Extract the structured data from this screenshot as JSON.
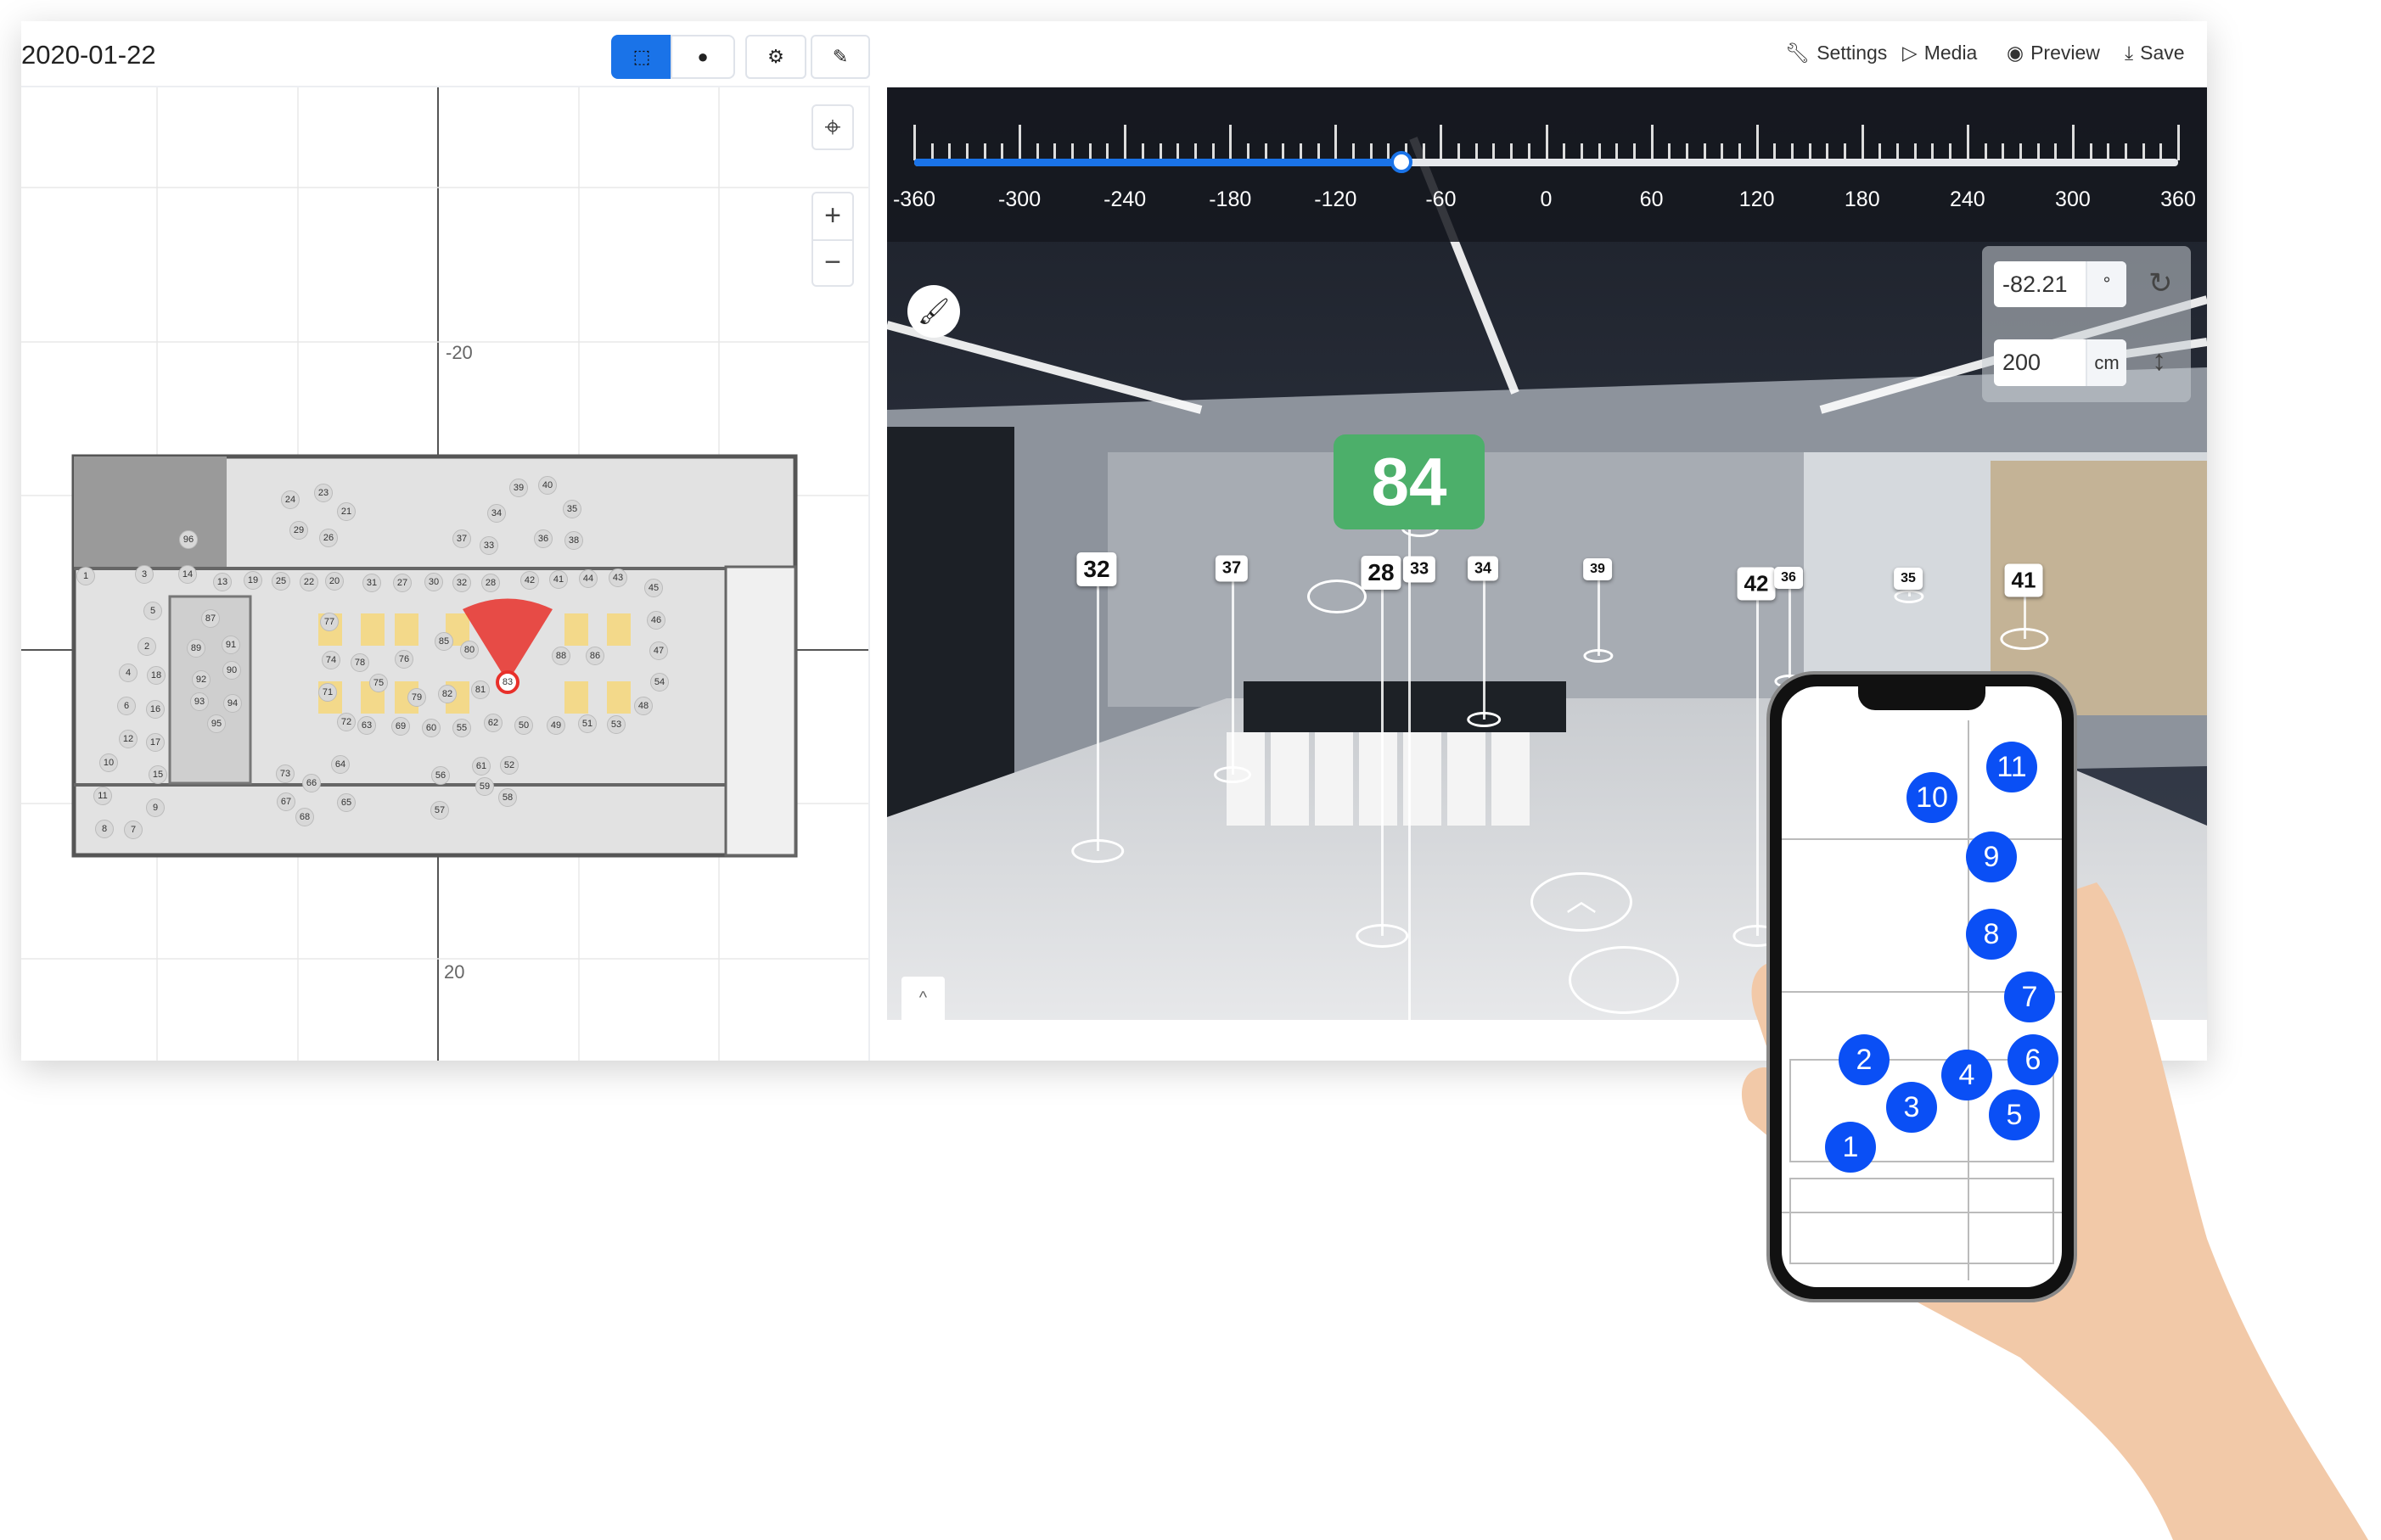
{
  "left_panel": {
    "date": "2020-01-22",
    "tools": [
      {
        "name": "select",
        "icon": "select-cursor-icon"
      },
      {
        "name": "pan",
        "icon": "hand-icon"
      },
      {
        "name": "settings",
        "icon": "gear-icon"
      },
      {
        "name": "edit",
        "icon": "pencil-icon"
      }
    ],
    "map": {
      "axis_labels": [
        "-20",
        "20"
      ],
      "zoom_in": "+",
      "zoom_out": "−",
      "seats": [
        "1",
        "3",
        "14",
        "13",
        "19",
        "25",
        "22",
        "20",
        "31",
        "27",
        "30",
        "32",
        "28",
        "42",
        "41",
        "44",
        "43",
        "45",
        "96",
        "24",
        "23",
        "21",
        "29",
        "26",
        "39",
        "40",
        "34",
        "35",
        "37",
        "33",
        "36",
        "38",
        "5",
        "87",
        "77",
        "46",
        "2",
        "89",
        "91",
        "85",
        "80",
        "88",
        "86",
        "47",
        "74",
        "78",
        "76",
        "4",
        "18",
        "92",
        "90",
        "75",
        "54",
        "71",
        "79",
        "82",
        "81",
        "6",
        "16",
        "93",
        "94",
        "48",
        "95",
        "72",
        "63",
        "69",
        "60",
        "55",
        "62",
        "50",
        "49",
        "51",
        "53",
        "12",
        "17",
        "10",
        "64",
        "61",
        "52",
        "15",
        "73",
        "66",
        "56",
        "59",
        "11",
        "67",
        "65",
        "58",
        "9",
        "57",
        "68",
        "8",
        "7"
      ],
      "selected_seat": "83",
      "selected_color": "#e8302a"
    }
  },
  "right_panel": {
    "toolbar": [
      {
        "label": "Settings",
        "icon": "wrench-icon"
      },
      {
        "label": "Media",
        "icon": "media-play-icon"
      },
      {
        "label": "Preview",
        "icon": "eye-icon"
      },
      {
        "label": "Save",
        "icon": "download-icon"
      }
    ],
    "heading_slider": {
      "min": -360,
      "max": 360,
      "value": -82.21,
      "ticks": [
        "-360",
        "-300",
        "-240",
        "-180",
        "-120",
        "-60",
        "0",
        "60",
        "120",
        "180",
        "240",
        "300",
        "360"
      ],
      "accent": "#1a73e8"
    },
    "rotation": {
      "value": "-82.21",
      "unit": "°"
    },
    "height": {
      "value": "200",
      "unit": "cm"
    },
    "current_marker": {
      "label": "84",
      "color": "#4caf6a"
    },
    "markers": [
      "32",
      "37",
      "28",
      "33",
      "34",
      "39",
      "42",
      "36",
      "35",
      "41"
    ],
    "collapse_label": "^"
  },
  "phone": {
    "pins": [
      "1",
      "2",
      "3",
      "4",
      "5",
      "6",
      "7",
      "8",
      "9",
      "10",
      "11"
    ],
    "pin_color": "#0a4ff5"
  }
}
